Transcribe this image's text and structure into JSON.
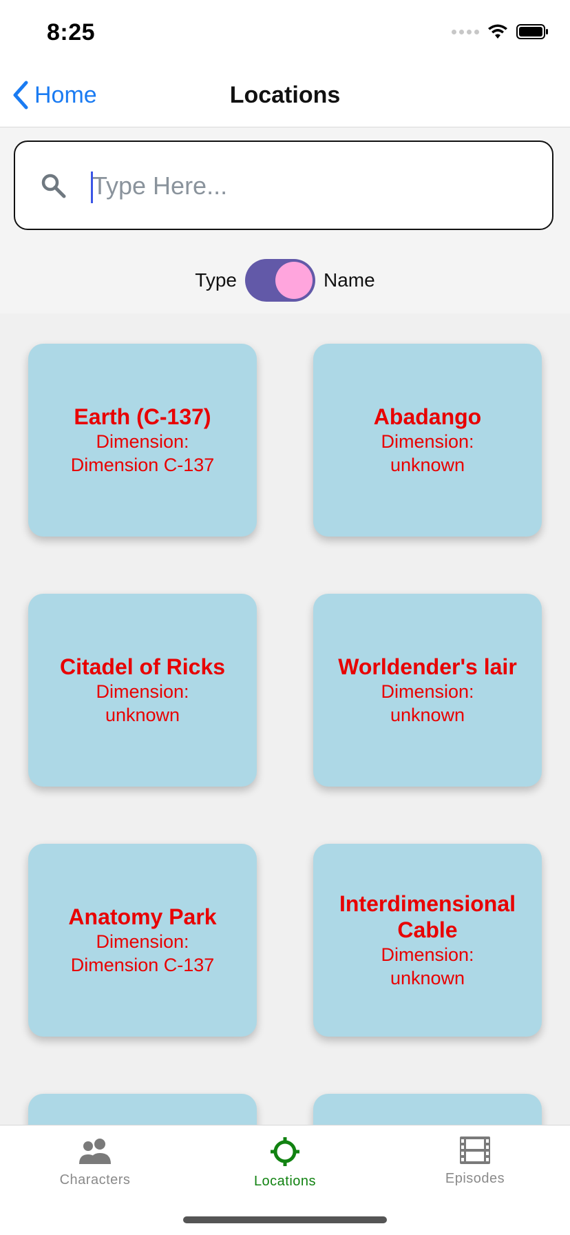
{
  "status_bar": {
    "time": "8:25"
  },
  "nav": {
    "back_label": "Home",
    "title": "Locations"
  },
  "search": {
    "placeholder": "Type Here...",
    "value": ""
  },
  "filter_toggle": {
    "left_label": "Type",
    "right_label": "Name",
    "state": "Name"
  },
  "locations": [
    {
      "name": "Earth (C-137)",
      "dimension_line1": "Dimension:",
      "dimension_line2": "Dimension C-137"
    },
    {
      "name": "Abadango",
      "dimension_line1": "Dimension:",
      "dimension_line2": "unknown"
    },
    {
      "name": "Citadel of Ricks",
      "dimension_line1": "Dimension:",
      "dimension_line2": "unknown"
    },
    {
      "name": "Worldender's lair",
      "dimension_line1": "Dimension:",
      "dimension_line2": "unknown"
    },
    {
      "name": "Anatomy Park",
      "dimension_line1": "Dimension:",
      "dimension_line2": "Dimension C-137"
    },
    {
      "name": "Interdimensional Cable",
      "dimension_line1": "Dimension:",
      "dimension_line2": "unknown"
    }
  ],
  "tabs": [
    {
      "label": "Characters",
      "icon": "people-icon",
      "active": false
    },
    {
      "label": "Locations",
      "icon": "location-target-icon",
      "active": true
    },
    {
      "label": "Episodes",
      "icon": "film-icon",
      "active": false
    }
  ],
  "colors": {
    "accent_blue": "#1a7bf2",
    "card_bg": "#add8e6",
    "card_text": "#e80000",
    "toggle_track": "#6259a8",
    "toggle_knob": "#ffa5dd",
    "active_tab": "#118211",
    "inactive_tab": "#8a8a8a"
  }
}
